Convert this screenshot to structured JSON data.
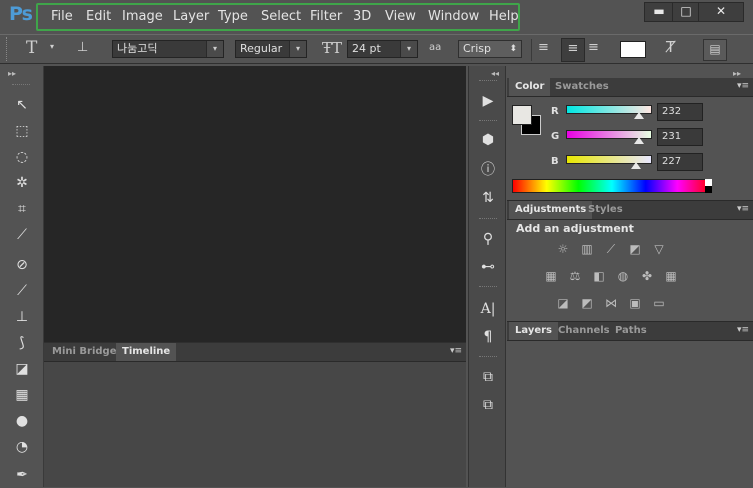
{
  "app": {
    "logo": "Ps"
  },
  "menu": [
    "File",
    "Edit",
    "Image",
    "Layer",
    "Type",
    "Select",
    "Filter",
    "3D",
    "View",
    "Window",
    "Help"
  ],
  "window_controls": {
    "minimize": "▬",
    "maximize": "□",
    "close": "✕"
  },
  "options": {
    "tool_glyph": "T",
    "font_family": "나눔고딕",
    "font_style": "Regular",
    "font_size": "24 pt",
    "antialias_icon": "aa",
    "antialias": "Crisp",
    "dropdown_arrow": "▾",
    "spinner_arrow": "⬍"
  },
  "bottom_panel": {
    "tabs": [
      "Mini Bridge",
      "Timeline"
    ],
    "active": "Timeline"
  },
  "color_panel": {
    "tabs": [
      "Color",
      "Swatches"
    ],
    "channels": [
      {
        "label": "R",
        "value": "232"
      },
      {
        "label": "G",
        "value": "231"
      },
      {
        "label": "B",
        "value": "227"
      }
    ],
    "fg_color": "#e8e7e3",
    "bg_color": "#000000"
  },
  "adjustments_panel": {
    "tabs": [
      "Adjustments",
      "Styles"
    ],
    "heading": "Add an adjustment"
  },
  "layers_panel": {
    "tabs": [
      "Layers",
      "Channels",
      "Paths"
    ]
  },
  "panel_menu_glyph": "▾≡",
  "collapse_glyph": "▸▸",
  "expand_glyph": "◂◂"
}
